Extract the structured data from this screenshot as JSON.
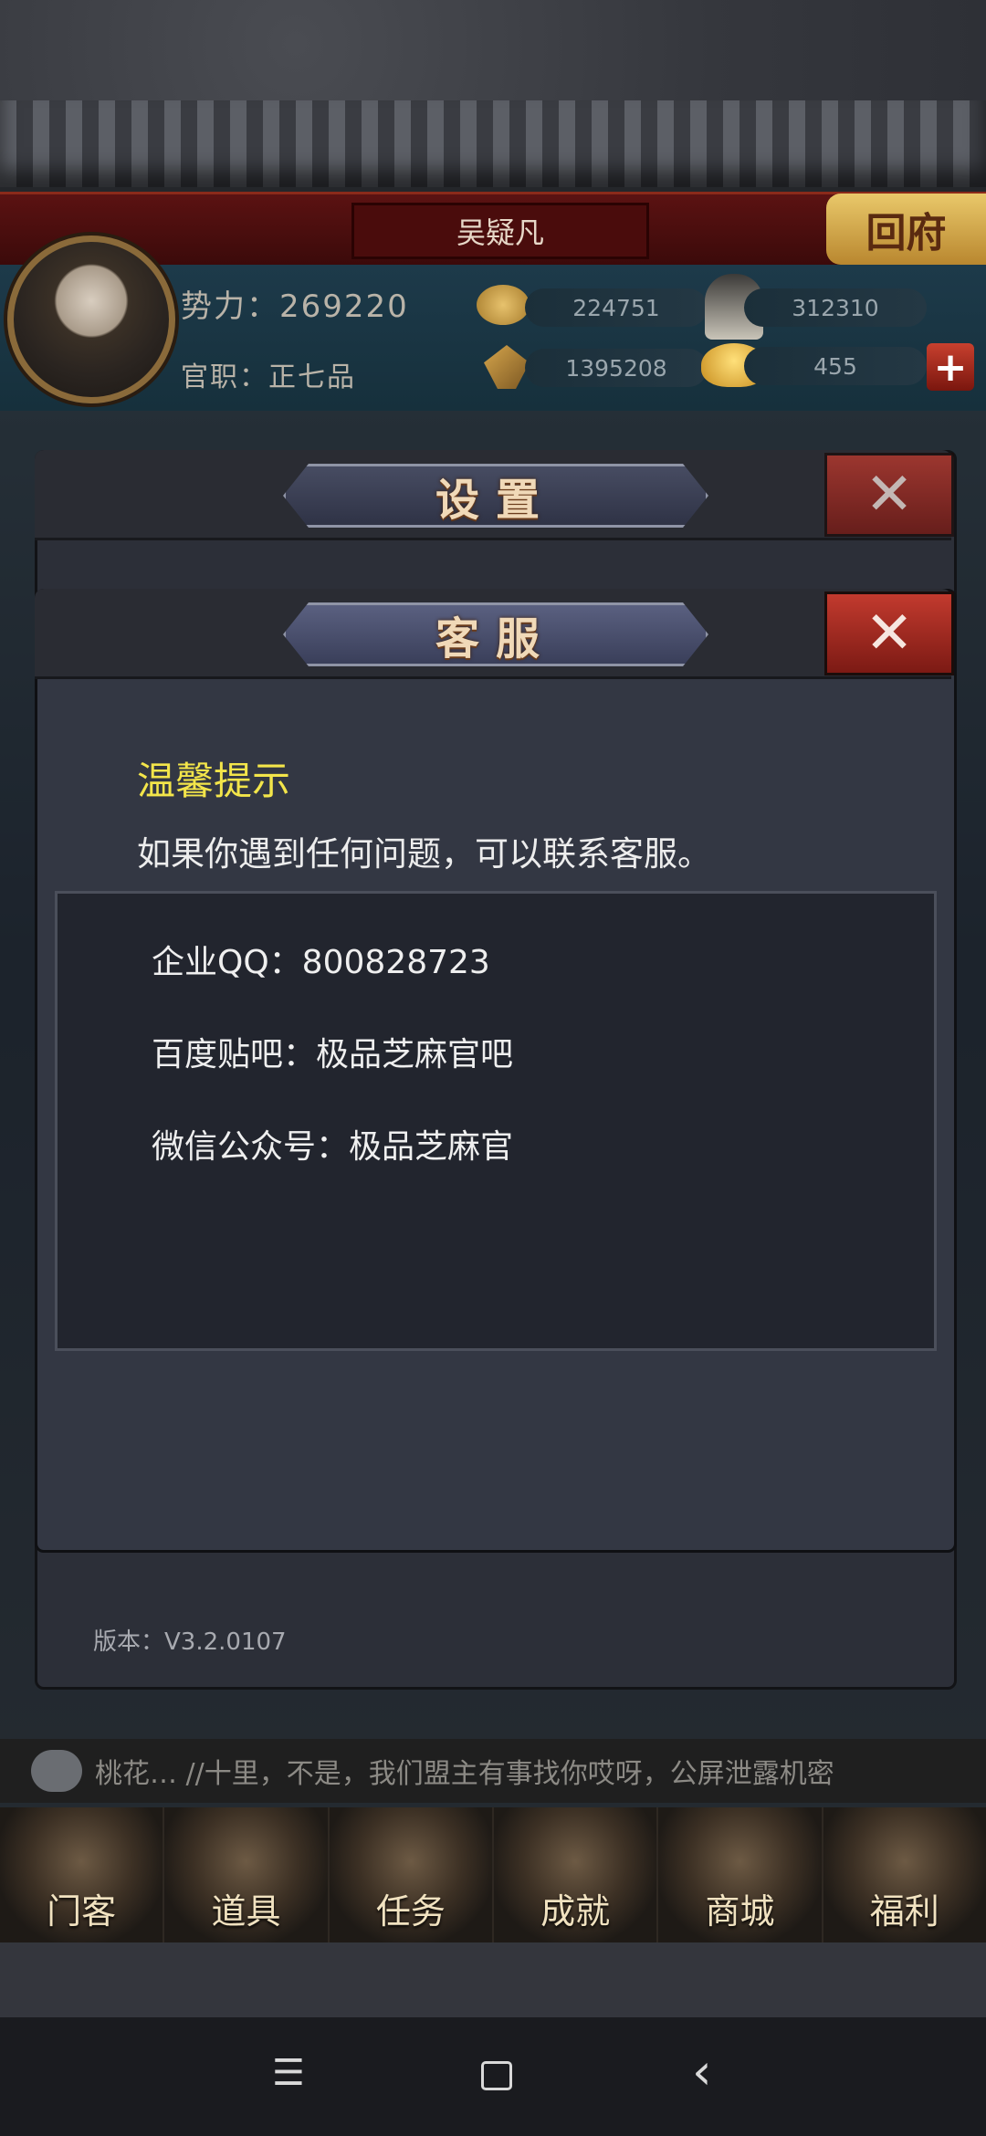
{
  "header": {
    "player_name": "吴疑凡",
    "home_button": "回府",
    "power": "势力：269220",
    "rank": "官职：正七品",
    "resources": {
      "coins": "224751",
      "soldiers": "312310",
      "grain": "1395208",
      "gold": "455"
    }
  },
  "settings_dialog": {
    "title": "设置",
    "version": "版本：V3.2.0107"
  },
  "cs_dialog": {
    "title": "客服",
    "tip_title": "温馨提示",
    "tip_body": "如果你遇到任何问题，可以联系客服。",
    "contacts": [
      "企业QQ：800828723",
      "百度贴吧：极品芝麻官吧",
      "微信公众号：极品芝麻官"
    ]
  },
  "chat": {
    "message": "桃花… //十里，不是，我们盟主有事找你哎呀，公屏泄露机密"
  },
  "bottom_nav": [
    "门客",
    "道具",
    "任务",
    "成就",
    "商城",
    "福利"
  ],
  "system_nav": {
    "menu": "☰",
    "home": "□",
    "back": "‹"
  }
}
